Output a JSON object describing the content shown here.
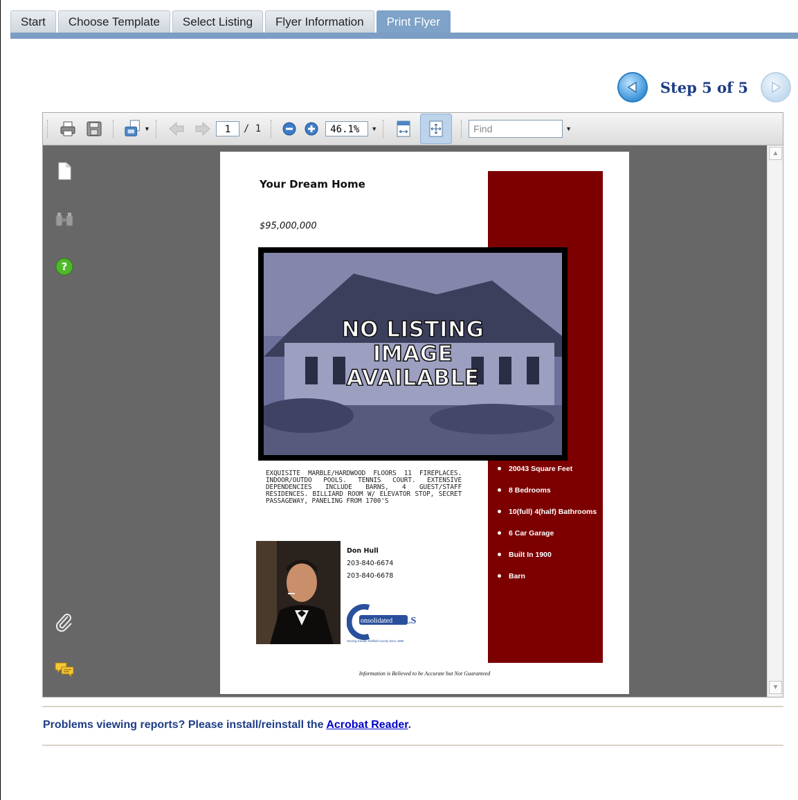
{
  "tabs": [
    "Start",
    "Choose Template",
    "Select Listing",
    "Flyer Information",
    "Print Flyer"
  ],
  "active_tab": "Print Flyer",
  "step_nav": {
    "label": "Step 5 of 5"
  },
  "pdf_toolbar": {
    "page_current": "1",
    "page_total": "/ 1",
    "zoom": "46.1%",
    "find_placeholder": "Find"
  },
  "flyer": {
    "title": "Your Dream Home",
    "price": "$95,000,000",
    "no_image_line1": "NO LISTING",
    "no_image_line2": "IMAGE",
    "no_image_line3": "AVAILABLE",
    "description": "EXQUISITE MARBLE/HARDWOOD FLOORS 11 FIREPLACES. INDOOR/OUTDO POOLS. TENNIS COURT. EXTENSIVE DEPENDENCIES INCLUDE BARNS, 4 GUEST/STAFF RESIDENCES. BILLIARD ROOM W/ ELEVATOR STOP, SECRET PASSAGEWAY, PANELING FROM 1700'S",
    "features": [
      "20043 Square Feet",
      "8 Bedrooms",
      "10(full) 4(half) Bathrooms",
      "6 Car Garage",
      "Built In 1900",
      "Barn"
    ],
    "agent_name": "Don Hull",
    "agent_phone1": "203-840-6674",
    "agent_phone2": "203-840-6678",
    "logo_text": "onsolidated",
    "logo_mls": "MLS",
    "logo_tagline": "Serving Greater Fairfield County Since 1996",
    "disclaimer": "Information is Believed to be Accurate but Not Guaranteed"
  },
  "footer": {
    "problems_text": "Problems viewing reports? Please install/reinstall the ",
    "link_text": "Acrobat Reader",
    "period": "."
  },
  "colors": {
    "tab_active": "#7ea2c8",
    "tab_bar": "#7c9dc4",
    "flyer_red": "#7c0000",
    "step_text": "#1d3d86"
  }
}
